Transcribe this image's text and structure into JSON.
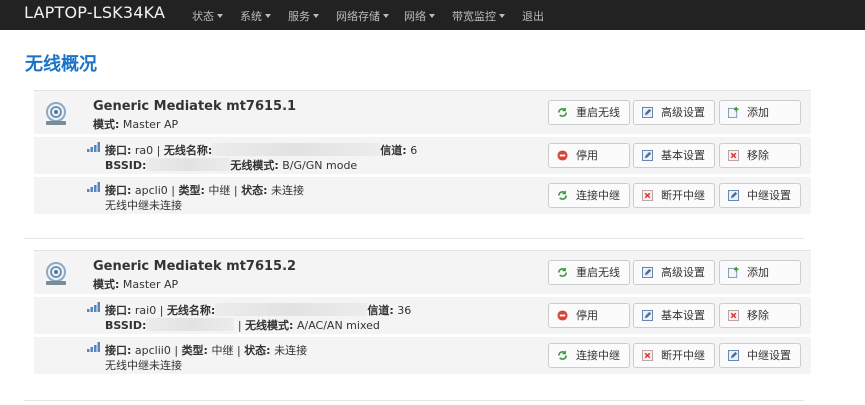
{
  "brand": "LAPTOP-LSK34KA",
  "nav": [
    {
      "label": "状态"
    },
    {
      "label": "系统"
    },
    {
      "label": "服务"
    },
    {
      "label": "网络存储"
    },
    {
      "label": "网络"
    },
    {
      "label": "带宽监控"
    },
    {
      "label": "退出"
    }
  ],
  "page_title": "无线概况",
  "devices": [
    {
      "name": "Generic Mediatek mt7615.1",
      "mode_label": "模式:",
      "mode_value": "Master AP",
      "buttons": {
        "restart": "重启无线",
        "advanced": "高级设置",
        "add": "添加"
      },
      "ap": {
        "iface_label": "接口:",
        "iface": "ra0",
        "ssid_label": "无线名称:",
        "channel_label": "信道:",
        "channel": "6",
        "bssid_label": "BSSID:",
        "wmode_label": "无线模式:",
        "wmode": "B/G/GN mode",
        "buttons": {
          "disable": "停用",
          "basic": "基本设置",
          "remove": "移除"
        }
      },
      "relay": {
        "iface_label": "接口:",
        "iface": "apcli0",
        "type_label": "类型:",
        "type": "中继",
        "status_label": "状态:",
        "status": "未连接",
        "note": "无线中继未连接",
        "buttons": {
          "connect": "连接中继",
          "disconnect": "断开中继",
          "settings": "中继设置"
        }
      }
    },
    {
      "name": "Generic Mediatek mt7615.2",
      "mode_label": "模式:",
      "mode_value": "Master AP",
      "buttons": {
        "restart": "重启无线",
        "advanced": "高级设置",
        "add": "添加"
      },
      "ap": {
        "iface_label": "接口:",
        "iface": "rai0",
        "ssid_label": "无线名称:",
        "channel_label": "信道:",
        "channel": "36",
        "bssid_label": "BSSID:",
        "wmode_label": "无线模式:",
        "wmode": "A/AC/AN mixed",
        "buttons": {
          "disable": "停用",
          "basic": "基本设置",
          "remove": "移除"
        }
      },
      "relay": {
        "iface_label": "接口:",
        "iface": "apclii0",
        "type_label": "类型:",
        "type": "中继",
        "status_label": "状态:",
        "status": "未连接",
        "note": "无线中继未连接",
        "buttons": {
          "connect": "连接中继",
          "disconnect": "断开中继",
          "settings": "中继设置"
        }
      }
    }
  ],
  "colors": {
    "navbar": "#222222",
    "title": "#1a73c6",
    "row_bg": "#f4f4f4"
  }
}
